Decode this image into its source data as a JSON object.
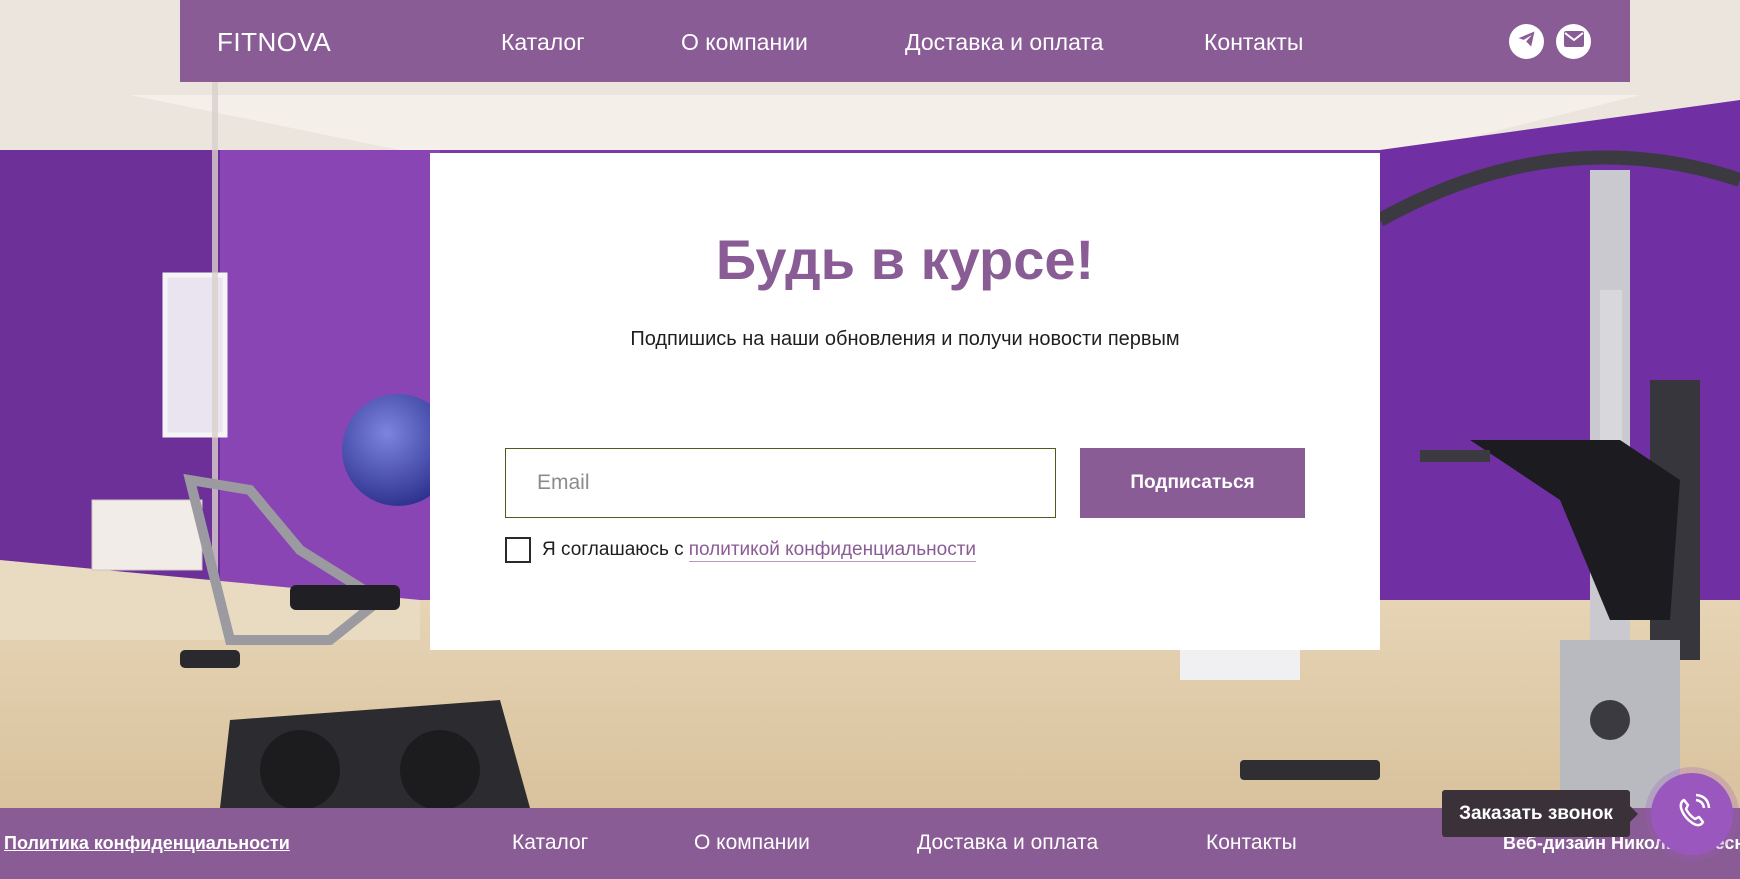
{
  "header": {
    "logo": "FITNOVA",
    "nav": [
      "Каталог",
      "О компании",
      "Доставка и оплата",
      "Контакты"
    ],
    "social_icons": [
      "telegram-icon",
      "mail-icon"
    ]
  },
  "subscribe": {
    "title": "Будь в курсе!",
    "subtitle": "Подпишись на наши обновления и получи новости первым",
    "email_placeholder": "Email",
    "email_value": "",
    "button_label": "Подписаться",
    "consent_text": "Я соглашаюсь с",
    "consent_link": "политикой конфиденциальности",
    "consent_checked": false
  },
  "footer": {
    "policy": "Политика конфиденциальности",
    "nav": [
      "Каталог",
      "О компании",
      "Доставка и оплата",
      "Контакты"
    ],
    "credit": "Веб-дизайн Николь Колесн"
  },
  "callback": {
    "label": "Заказать звонок",
    "icon": "phone-icon"
  },
  "colors": {
    "brand": "#8a5c95",
    "callback_accent": "#9a57be",
    "wall": "#7b39a8"
  }
}
